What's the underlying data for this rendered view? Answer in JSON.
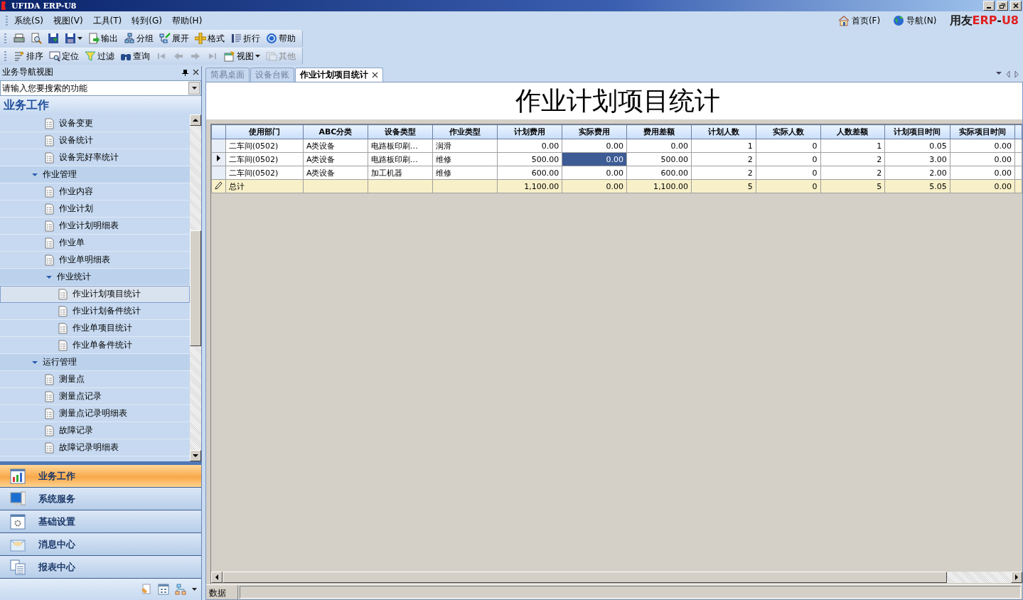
{
  "window": {
    "title": "UFIDA ERP-U8"
  },
  "menu": [
    "系统(S)",
    "视图(V)",
    "工具(T)",
    "转到(G)",
    "帮助(H)"
  ],
  "top_links": [
    {
      "label": "首页(F)"
    },
    {
      "label": "导航(N)"
    }
  ],
  "logo_parts": [
    {
      "text": "用友",
      "color": "#1a1a1a"
    },
    {
      "text": "ERP",
      "color": "#e02020"
    },
    {
      "text": "-",
      "color": "#1a1a1a"
    },
    {
      "text": "U8",
      "color": "#e02020"
    }
  ],
  "toolbar_1": [
    {
      "kind": "icon",
      "disabled": false
    },
    {
      "kind": "icon",
      "disabled": false
    },
    {
      "kind": "icon",
      "disabled": false
    },
    {
      "kind": "icon",
      "disabled": false,
      "dropdown": true
    },
    {
      "kind": "labeled",
      "label": "输出",
      "disabled": false
    },
    {
      "kind": "labeled",
      "label": "分组",
      "disabled": false
    },
    {
      "kind": "labeled",
      "label": "展开",
      "disabled": false
    },
    {
      "kind": "labeled",
      "label": "格式",
      "disabled": false
    },
    {
      "kind": "labeled",
      "label": "折行",
      "disabled": false
    },
    {
      "kind": "labeled",
      "label": "帮助",
      "disabled": false
    }
  ],
  "toolbar_2": [
    {
      "kind": "labeled",
      "label": "排序",
      "disabled": false
    },
    {
      "kind": "labeled",
      "label": "定位",
      "disabled": false
    },
    {
      "kind": "labeled",
      "label": "过滤",
      "disabled": false
    },
    {
      "kind": "labeled",
      "label": "查询",
      "disabled": false
    },
    {
      "kind": "icon",
      "disabled": true
    },
    {
      "kind": "icon",
      "disabled": true
    },
    {
      "kind": "icon",
      "disabled": true
    },
    {
      "kind": "icon",
      "disabled": true
    },
    {
      "kind": "labeled",
      "label": "视图",
      "disabled": false,
      "dropdown": true
    },
    {
      "kind": "labeled",
      "label": "其他",
      "disabled": true
    }
  ],
  "sidebar": {
    "title": "业务导航视图",
    "search": {
      "value": "请输入您要搜索的功能"
    },
    "section": "业务工作",
    "tree": [
      {
        "label": "设备变更",
        "selected": false
      },
      {
        "label": "设备统计",
        "selected": false
      },
      {
        "label": "设备完好率统计",
        "selected": false
      },
      {
        "label": "作业管理",
        "expanded": true,
        "selected": false,
        "children": [
          {
            "label": "作业内容",
            "selected": false
          },
          {
            "label": "作业计划",
            "selected": false
          },
          {
            "label": "作业计划明细表",
            "selected": false
          },
          {
            "label": "作业单",
            "selected": false
          },
          {
            "label": "作业单明细表",
            "selected": false
          },
          {
            "label": "作业统计",
            "expanded": true,
            "selected": false,
            "children": [
              {
                "label": "作业计划项目统计",
                "selected": true
              },
              {
                "label": "作业计划备件统计",
                "selected": false
              },
              {
                "label": "作业单项目统计",
                "selected": false
              },
              {
                "label": "作业单备件统计",
                "selected": false
              }
            ]
          }
        ]
      },
      {
        "label": "运行管理",
        "expanded": true,
        "selected": false,
        "children": [
          {
            "label": "测量点",
            "selected": false
          },
          {
            "label": "测量点记录",
            "selected": false
          },
          {
            "label": "测量点记录明细表",
            "selected": false
          },
          {
            "label": "故障记录",
            "selected": false
          },
          {
            "label": "故障记录明细表",
            "selected": false
          }
        ]
      }
    ],
    "nav_buttons": [
      {
        "label": "业务工作",
        "selected": true
      },
      {
        "label": "系统服务",
        "selected": false
      },
      {
        "label": "基础设置",
        "selected": false
      },
      {
        "label": "消息中心",
        "selected": false
      },
      {
        "label": "报表中心",
        "selected": false
      }
    ]
  },
  "tabs": [
    {
      "label": "简易桌面",
      "selected": false,
      "closable": false
    },
    {
      "label": "设备台账",
      "selected": false,
      "closable": false
    },
    {
      "label": "作业计划项目统计",
      "selected": true,
      "closable": true
    }
  ],
  "report": {
    "title": "作业计划项目统计",
    "columns": [
      {
        "label": "使用部门",
        "kind": "text"
      },
      {
        "label": "ABC分类",
        "kind": "text"
      },
      {
        "label": "设备类型",
        "kind": "text"
      },
      {
        "label": "作业类型",
        "kind": "text"
      },
      {
        "label": "计划费用",
        "kind": "number"
      },
      {
        "label": "实际费用",
        "kind": "number"
      },
      {
        "label": "费用差额",
        "kind": "number"
      },
      {
        "label": "计划人数",
        "kind": "number"
      },
      {
        "label": "实际人数",
        "kind": "number"
      },
      {
        "label": "人数差额",
        "kind": "number"
      },
      {
        "label": "计划项目时间",
        "kind": "number"
      },
      {
        "label": "实际项目时间",
        "kind": "number"
      }
    ],
    "rows": [
      {
        "kind": "data",
        "current": false,
        "cells": [
          {
            "text": "二车间(0502)",
            "selected": false
          },
          {
            "text": "A类设备",
            "selected": false
          },
          {
            "text": "电路板印刷…",
            "selected": false
          },
          {
            "text": "润滑",
            "selected": false
          },
          {
            "text": "0.00",
            "selected": false
          },
          {
            "text": "0.00",
            "selected": false
          },
          {
            "text": "0.00",
            "selected": false
          },
          {
            "text": "1",
            "selected": false
          },
          {
            "text": "0",
            "selected": false
          },
          {
            "text": "1",
            "selected": false
          },
          {
            "text": "0.05",
            "selected": false
          },
          {
            "text": "0.00",
            "selected": false
          }
        ]
      },
      {
        "kind": "data",
        "current": true,
        "cells": [
          {
            "text": "二车间(0502)",
            "selected": false
          },
          {
            "text": "A类设备",
            "selected": false
          },
          {
            "text": "电路板印刷…",
            "selected": false
          },
          {
            "text": "维修",
            "selected": false
          },
          {
            "text": "500.00",
            "selected": false
          },
          {
            "text": "0.00",
            "selected": true
          },
          {
            "text": "500.00",
            "selected": false
          },
          {
            "text": "2",
            "selected": false
          },
          {
            "text": "0",
            "selected": false
          },
          {
            "text": "2",
            "selected": false
          },
          {
            "text": "3.00",
            "selected": false
          },
          {
            "text": "0.00",
            "selected": false
          }
        ]
      },
      {
        "kind": "data",
        "current": false,
        "cells": [
          {
            "text": "二车间(0502)",
            "selected": false
          },
          {
            "text": "A类设备",
            "selected": false
          },
          {
            "text": "加工机器",
            "selected": false
          },
          {
            "text": "维修",
            "selected": false
          },
          {
            "text": "600.00",
            "selected": false
          },
          {
            "text": "0.00",
            "selected": false
          },
          {
            "text": "600.00",
            "selected": false
          },
          {
            "text": "2",
            "selected": false
          },
          {
            "text": "0",
            "selected": false
          },
          {
            "text": "2",
            "selected": false
          },
          {
            "text": "2.00",
            "selected": false
          },
          {
            "text": "0.00",
            "selected": false
          }
        ]
      },
      {
        "kind": "total",
        "cells": [
          {
            "text": "总计",
            "selected": false
          },
          {
            "text": "",
            "selected": false
          },
          {
            "text": "",
            "selected": false
          },
          {
            "text": "",
            "selected": false
          },
          {
            "text": "1,100.00",
            "selected": false
          },
          {
            "text": "0.00",
            "selected": false
          },
          {
            "text": "1,100.00",
            "selected": false
          },
          {
            "text": "5",
            "selected": false
          },
          {
            "text": "0",
            "selected": false
          },
          {
            "text": "5",
            "selected": false
          },
          {
            "text": "5.05",
            "selected": false
          },
          {
            "text": "0.00",
            "selected": false
          }
        ]
      }
    ]
  },
  "status_bar": {
    "label": "数据"
  }
}
